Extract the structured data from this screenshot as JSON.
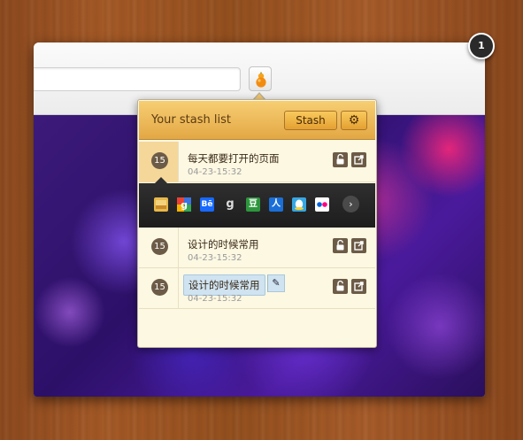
{
  "popup": {
    "title": "Your stash list",
    "stash_label": "Stash"
  },
  "items": [
    {
      "count": "15",
      "title": "每天都要打开的页面",
      "time": "04-23-15:32"
    },
    {
      "count": "15",
      "title": "设计的时候常用",
      "time": "04-23-15:32"
    },
    {
      "count": "15",
      "title": "设计的时候常用",
      "time": "04-23-15:32"
    }
  ],
  "icon_strip": {
    "icons": [
      {
        "name": "bookmark-icon",
        "color": "#e8b84a",
        "glyph": ""
      },
      {
        "name": "google-icon",
        "color": "#3b73e0",
        "glyph": "g"
      },
      {
        "name": "behance-icon",
        "color": "#1769ff",
        "glyph": "Bē"
      },
      {
        "name": "goodreads-icon",
        "color": "#2b2b2b",
        "glyph": "g"
      },
      {
        "name": "douban-icon",
        "color": "#2d963d",
        "glyph": "豆"
      },
      {
        "name": "renren-icon",
        "color": "#1b6fd8",
        "glyph": "人"
      },
      {
        "name": "qq-icon",
        "color": "#36a7e3",
        "glyph": ""
      },
      {
        "name": "flickr-icon",
        "color": "#ffffff",
        "glyph": ""
      }
    ]
  },
  "notification": {
    "count": "1"
  },
  "colors": {
    "header": "#e8b04f",
    "list_bg": "#fdf8e2",
    "badge": "#6c5b46"
  }
}
